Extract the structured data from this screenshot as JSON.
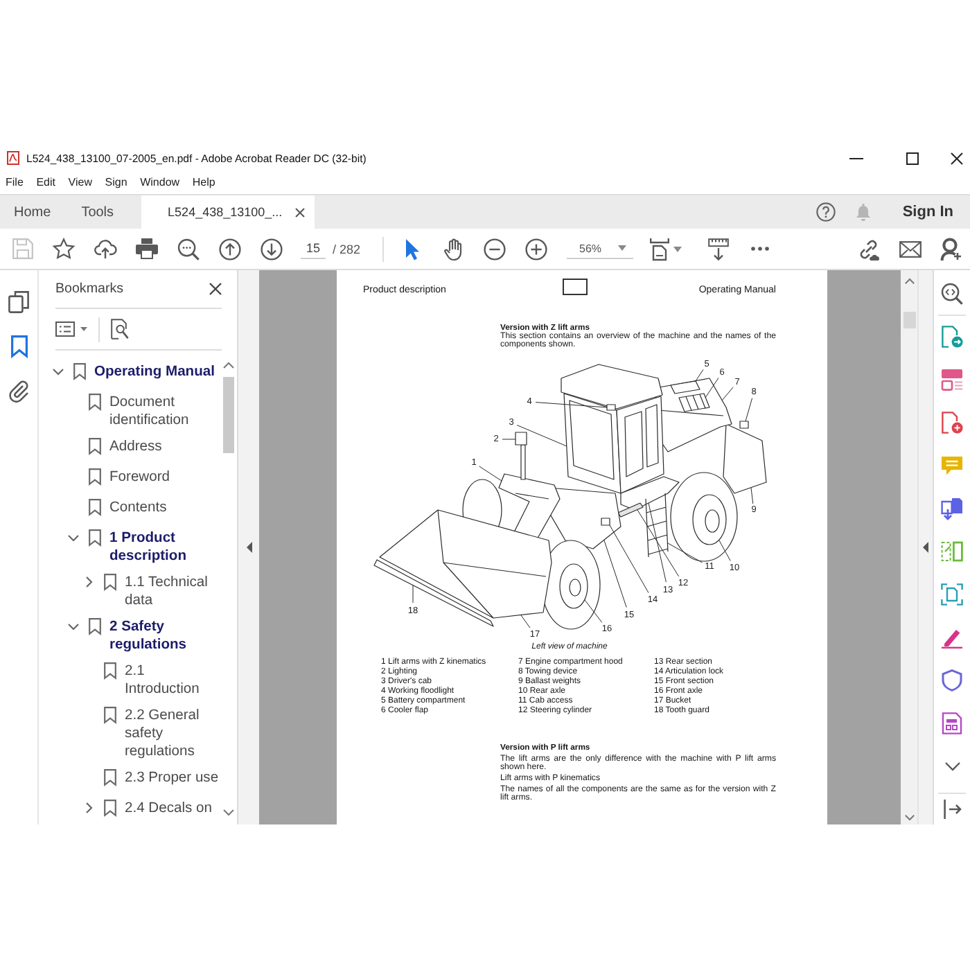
{
  "window": {
    "title": "L524_438_13100_07-2005_en.pdf - Adobe Acrobat Reader DC (32-bit)"
  },
  "menu": [
    "File",
    "Edit",
    "View",
    "Sign",
    "Window",
    "Help"
  ],
  "tabs": [
    {
      "label": "Home",
      "selected": false,
      "closable": false
    },
    {
      "label": "Tools",
      "selected": false,
      "closable": false
    },
    {
      "label": "L524_438_13100_...",
      "selected": true,
      "closable": true
    }
  ],
  "account": {
    "sign_in": "Sign In"
  },
  "toolbar": {
    "page": "15",
    "page_total": "/ 282",
    "zoom": "56%",
    "tools": [
      {
        "kind": "select",
        "selected": true
      },
      {
        "kind": "hand",
        "selected": false
      }
    ]
  },
  "nav_rail": [
    {
      "kind": "pages",
      "selected": false
    },
    {
      "kind": "bookmarks",
      "selected": true
    },
    {
      "kind": "attachments",
      "selected": false
    }
  ],
  "bookmarks": {
    "title": "Bookmarks",
    "items": [
      {
        "label": "Operating Manual",
        "bold": true,
        "expanded": true,
        "children": [
          {
            "label": "Document identification",
            "bold": false
          },
          {
            "label": "Address",
            "bold": false
          },
          {
            "label": "Foreword",
            "bold": false
          },
          {
            "label": "Contents",
            "bold": false
          },
          {
            "label": "1 Product description",
            "bold": true,
            "expanded": true,
            "children": [
              {
                "label": "1.1 Technical data",
                "bold": false,
                "expanded": false
              }
            ]
          },
          {
            "label": "2 Safety regulations",
            "bold": true,
            "expanded": true,
            "children": [
              {
                "label": "2.1 Introduction",
                "bold": false
              },
              {
                "label": "2.2 General safety regulations",
                "bold": false
              },
              {
                "label": "2.3 Proper use",
                "bold": false
              },
              {
                "label": "2.4 Decals on",
                "bold": false,
                "expanded": false
              }
            ]
          }
        ]
      }
    ]
  },
  "document": {
    "header_left": "Product description",
    "header_right": "Operating Manual",
    "intro": {
      "heading": "Version with Z lift arms",
      "text": "This section contains an overview of the machine and the names of the components shown."
    },
    "figure": {
      "callouts": [
        "1",
        "2",
        "3",
        "4",
        "5",
        "6",
        "7",
        "8",
        "9",
        "10",
        "11",
        "12",
        "13",
        "14",
        "15",
        "16",
        "17",
        "18"
      ],
      "caption": "Left view of machine",
      "legend": [
        "1 Lift arms with Z kinematics",
        "2 Lighting",
        "3 Driver's cab",
        "4 Working floodlight",
        "5 Battery compartment",
        "6 Cooler flap",
        "7 Engine compartment hood",
        "8 Towing device",
        "9 Ballast weights",
        "10 Rear axle",
        "11 Cab access",
        "12 Steering cylinder",
        "13 Rear section",
        "14 Articulation lock",
        "15 Front section",
        "16 Front axle",
        "17 Bucket",
        "18 Tooth guard"
      ]
    },
    "variant": {
      "heading": "Version with P lift arms",
      "paragraphs": [
        "The lift arms are the only difference with the machine with P lift arms shown here.",
        "Lift arms with P kinematics",
        "The names of all the components are the same as for the version with Z lift arms."
      ]
    }
  }
}
